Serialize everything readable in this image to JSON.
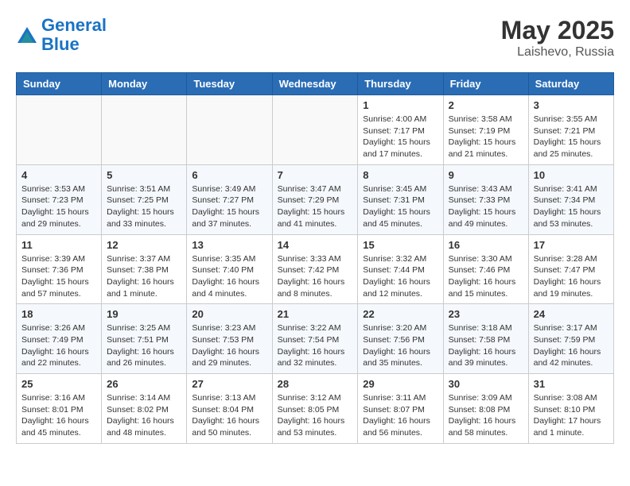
{
  "header": {
    "logo_line1": "General",
    "logo_line2": "Blue",
    "month": "May 2025",
    "location": "Laishevo, Russia"
  },
  "weekdays": [
    "Sunday",
    "Monday",
    "Tuesday",
    "Wednesday",
    "Thursday",
    "Friday",
    "Saturday"
  ],
  "weeks": [
    [
      {
        "day": "",
        "text": ""
      },
      {
        "day": "",
        "text": ""
      },
      {
        "day": "",
        "text": ""
      },
      {
        "day": "",
        "text": ""
      },
      {
        "day": "1",
        "text": "Sunrise: 4:00 AM\nSunset: 7:17 PM\nDaylight: 15 hours\nand 17 minutes."
      },
      {
        "day": "2",
        "text": "Sunrise: 3:58 AM\nSunset: 7:19 PM\nDaylight: 15 hours\nand 21 minutes."
      },
      {
        "day": "3",
        "text": "Sunrise: 3:55 AM\nSunset: 7:21 PM\nDaylight: 15 hours\nand 25 minutes."
      }
    ],
    [
      {
        "day": "4",
        "text": "Sunrise: 3:53 AM\nSunset: 7:23 PM\nDaylight: 15 hours\nand 29 minutes."
      },
      {
        "day": "5",
        "text": "Sunrise: 3:51 AM\nSunset: 7:25 PM\nDaylight: 15 hours\nand 33 minutes."
      },
      {
        "day": "6",
        "text": "Sunrise: 3:49 AM\nSunset: 7:27 PM\nDaylight: 15 hours\nand 37 minutes."
      },
      {
        "day": "7",
        "text": "Sunrise: 3:47 AM\nSunset: 7:29 PM\nDaylight: 15 hours\nand 41 minutes."
      },
      {
        "day": "8",
        "text": "Sunrise: 3:45 AM\nSunset: 7:31 PM\nDaylight: 15 hours\nand 45 minutes."
      },
      {
        "day": "9",
        "text": "Sunrise: 3:43 AM\nSunset: 7:33 PM\nDaylight: 15 hours\nand 49 minutes."
      },
      {
        "day": "10",
        "text": "Sunrise: 3:41 AM\nSunset: 7:34 PM\nDaylight: 15 hours\nand 53 minutes."
      }
    ],
    [
      {
        "day": "11",
        "text": "Sunrise: 3:39 AM\nSunset: 7:36 PM\nDaylight: 15 hours\nand 57 minutes."
      },
      {
        "day": "12",
        "text": "Sunrise: 3:37 AM\nSunset: 7:38 PM\nDaylight: 16 hours\nand 1 minute."
      },
      {
        "day": "13",
        "text": "Sunrise: 3:35 AM\nSunset: 7:40 PM\nDaylight: 16 hours\nand 4 minutes."
      },
      {
        "day": "14",
        "text": "Sunrise: 3:33 AM\nSunset: 7:42 PM\nDaylight: 16 hours\nand 8 minutes."
      },
      {
        "day": "15",
        "text": "Sunrise: 3:32 AM\nSunset: 7:44 PM\nDaylight: 16 hours\nand 12 minutes."
      },
      {
        "day": "16",
        "text": "Sunrise: 3:30 AM\nSunset: 7:46 PM\nDaylight: 16 hours\nand 15 minutes."
      },
      {
        "day": "17",
        "text": "Sunrise: 3:28 AM\nSunset: 7:47 PM\nDaylight: 16 hours\nand 19 minutes."
      }
    ],
    [
      {
        "day": "18",
        "text": "Sunrise: 3:26 AM\nSunset: 7:49 PM\nDaylight: 16 hours\nand 22 minutes."
      },
      {
        "day": "19",
        "text": "Sunrise: 3:25 AM\nSunset: 7:51 PM\nDaylight: 16 hours\nand 26 minutes."
      },
      {
        "day": "20",
        "text": "Sunrise: 3:23 AM\nSunset: 7:53 PM\nDaylight: 16 hours\nand 29 minutes."
      },
      {
        "day": "21",
        "text": "Sunrise: 3:22 AM\nSunset: 7:54 PM\nDaylight: 16 hours\nand 32 minutes."
      },
      {
        "day": "22",
        "text": "Sunrise: 3:20 AM\nSunset: 7:56 PM\nDaylight: 16 hours\nand 35 minutes."
      },
      {
        "day": "23",
        "text": "Sunrise: 3:18 AM\nSunset: 7:58 PM\nDaylight: 16 hours\nand 39 minutes."
      },
      {
        "day": "24",
        "text": "Sunrise: 3:17 AM\nSunset: 7:59 PM\nDaylight: 16 hours\nand 42 minutes."
      }
    ],
    [
      {
        "day": "25",
        "text": "Sunrise: 3:16 AM\nSunset: 8:01 PM\nDaylight: 16 hours\nand 45 minutes."
      },
      {
        "day": "26",
        "text": "Sunrise: 3:14 AM\nSunset: 8:02 PM\nDaylight: 16 hours\nand 48 minutes."
      },
      {
        "day": "27",
        "text": "Sunrise: 3:13 AM\nSunset: 8:04 PM\nDaylight: 16 hours\nand 50 minutes."
      },
      {
        "day": "28",
        "text": "Sunrise: 3:12 AM\nSunset: 8:05 PM\nDaylight: 16 hours\nand 53 minutes."
      },
      {
        "day": "29",
        "text": "Sunrise: 3:11 AM\nSunset: 8:07 PM\nDaylight: 16 hours\nand 56 minutes."
      },
      {
        "day": "30",
        "text": "Sunrise: 3:09 AM\nSunset: 8:08 PM\nDaylight: 16 hours\nand 58 minutes."
      },
      {
        "day": "31",
        "text": "Sunrise: 3:08 AM\nSunset: 8:10 PM\nDaylight: 17 hours\nand 1 minute."
      }
    ]
  ]
}
